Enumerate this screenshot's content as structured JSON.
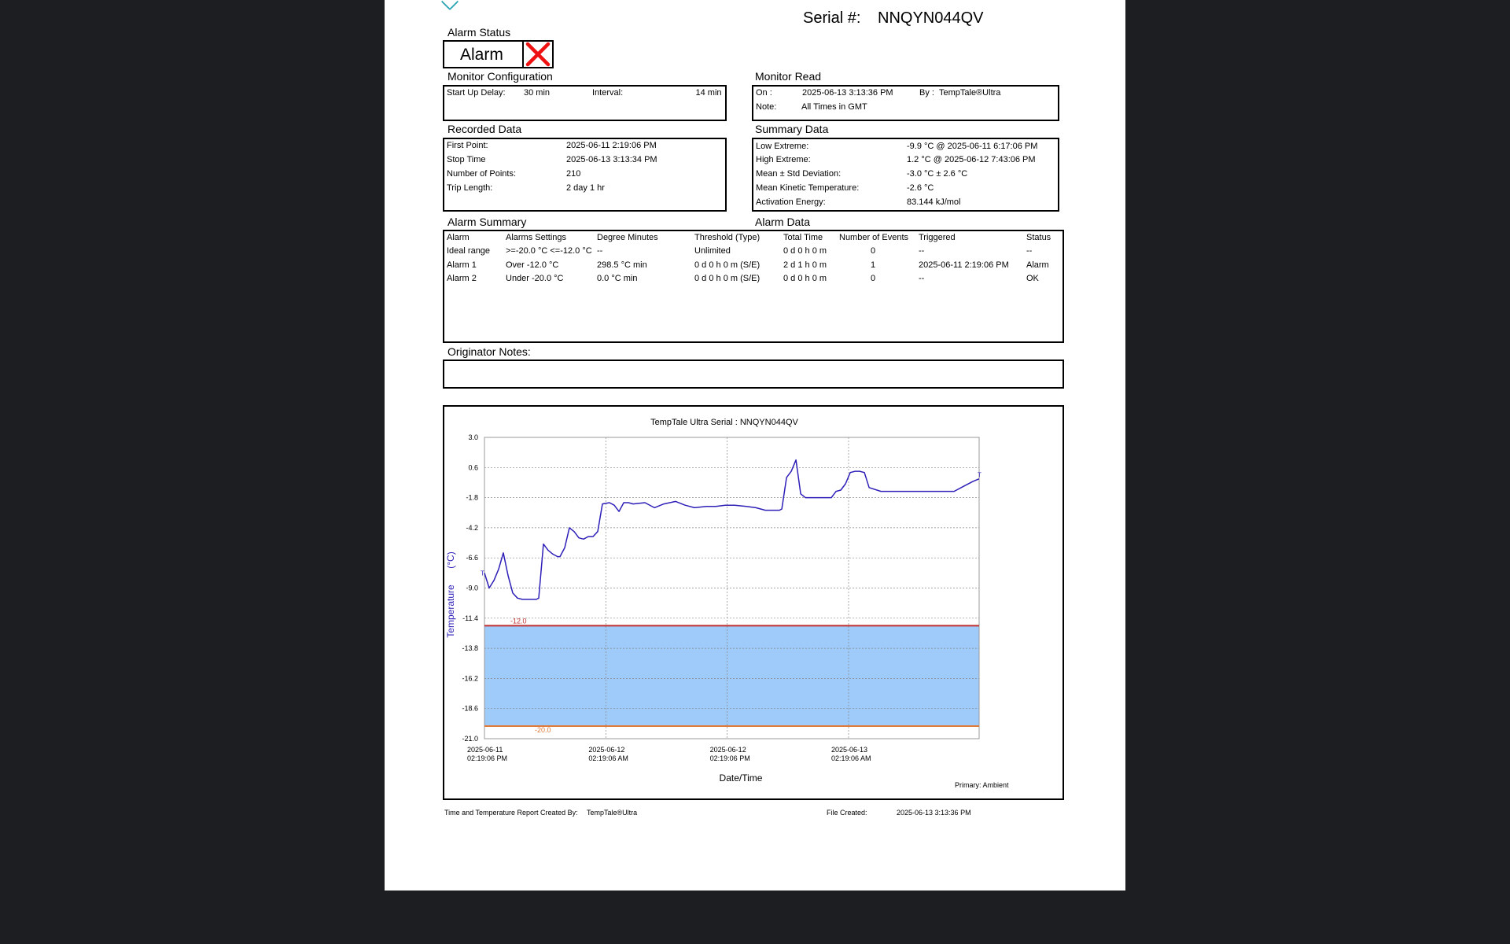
{
  "header": {
    "serial_label": "Serial #:",
    "serial_value": "NNQYN044QV"
  },
  "alarm_status": {
    "title": "Alarm Status",
    "value": "Alarm"
  },
  "monitor_config": {
    "title": "Monitor Configuration",
    "startup_delay_label": "Start Up Delay:",
    "startup_delay_value": "30 min",
    "interval_label": "Interval:",
    "interval_value": "14 min"
  },
  "monitor_read": {
    "title": "Monitor Read",
    "on_label": "On :",
    "on_value": "2025-06-13  3:13:36 PM",
    "by_label": "By :",
    "by_value": "TempTale®Ultra",
    "note_label": "Note:",
    "note_value": "All Times in GMT"
  },
  "recorded_data": {
    "title": "Recorded Data",
    "rows": [
      {
        "label": "First Point:",
        "value": "2025-06-11  2:19:06 PM"
      },
      {
        "label": "Stop Time",
        "value": "2025-06-13  3:13:34 PM"
      },
      {
        "label": "Number of Points:",
        "value": "210"
      },
      {
        "label": "Trip Length:",
        "value": "2 day 1 hr"
      }
    ]
  },
  "summary_data": {
    "title": "Summary Data",
    "rows": [
      {
        "label": "Low Extreme:",
        "value": "-9.9 °C @ 2025-06-11  6:17:06 PM"
      },
      {
        "label": "High Extreme:",
        "value": "1.2 °C @ 2025-06-12  7:43:06 PM"
      },
      {
        "label": "Mean ± Std Deviation:",
        "value": "-3.0 °C ± 2.6 °C"
      },
      {
        "label": "Mean Kinetic Temperature:",
        "value": "-2.6 °C"
      },
      {
        "label": "Activation Energy:",
        "value": "83.144 kJ/mol"
      }
    ]
  },
  "alarm_summary": {
    "title": "Alarm Summary",
    "data_title": "Alarm Data",
    "headers": [
      "Alarm",
      "Alarms Settings",
      "Degree Minutes",
      "Threshold (Type)",
      "Total Time",
      "Number of Events",
      "Triggered",
      "Status"
    ],
    "rows": [
      [
        "Ideal range",
        ">=-20.0 °C <=-12.0 °C",
        "--",
        "Unlimited",
        "0 d 0 h 0 m",
        "0",
        "--",
        "--"
      ],
      [
        "Alarm 1",
        "Over -12.0 °C",
        "298.5 °C min",
        "0 d 0 h 0 m (S/E)",
        "2 d 1 h 0 m",
        "1",
        "2025-06-11  2:19:06 PM",
        "Alarm"
      ],
      [
        "Alarm 2",
        "Under -20.0 °C",
        "0.0 °C min",
        "0 d 0 h 0 m (S/E)",
        "0 d 0 h 0 m",
        "0",
        "--",
        "OK"
      ]
    ]
  },
  "originator_notes": {
    "title": "Originator Notes:"
  },
  "footer": {
    "created_by_label": "Time and Temperature Report Created By:",
    "created_by_value": "TempTale®Ultra",
    "file_created_label": "File Created:",
    "file_created_value": "2025-06-13  3:13:36 PM"
  },
  "chart_data": {
    "type": "line",
    "title": "TempTale Ultra  Serial : NNQYN044QV",
    "xlabel": "Date/Time",
    "ylabel": "Temperature",
    "ylabel_unit": "(°C)",
    "primary_label": "Primary: Ambient",
    "ylim": [
      -21.0,
      3.0
    ],
    "y_ticks": [
      "3.0",
      "0.6",
      "-1.8",
      "-4.2",
      "-6.6",
      "-9.0",
      "-11.4",
      "-13.8",
      "-16.2",
      "-18.6",
      "-21.0"
    ],
    "x_ticks": [
      {
        "date": "2025-06-11",
        "time": "02:19:06 PM"
      },
      {
        "date": "2025-06-12",
        "time": "02:19:06 AM"
      },
      {
        "date": "2025-06-12",
        "time": "02:19:06 PM"
      },
      {
        "date": "2025-06-13",
        "time": "02:19:06 AM"
      }
    ],
    "xlim": [
      "2025-06-11 14:19:06",
      "2025-06-13 15:13:34"
    ],
    "upper_limit": -12.0,
    "lower_limit": -20.0,
    "upper_limit_label": "-12.0",
    "lower_limit_label": "-20.0",
    "trip_markers": [
      "T",
      "T"
    ],
    "band_color": "#9ecbfa",
    "line_color": "#2d1fb8",
    "upper_line_color": "#c03030",
    "lower_line_color": "#e07a3a",
    "series": [
      {
        "x": [
          "2025-06-11 14:19:06",
          "2025-06-11 14:47:06",
          "2025-06-11 15:15:06",
          "2025-06-11 15:43:06",
          "2025-06-11 16:11:06",
          "2025-06-11 16:39:06",
          "2025-06-11 17:07:06",
          "2025-06-11 17:35:06",
          "2025-06-11 18:03:06",
          "2025-06-11 18:31:06",
          "2025-06-11 18:59:06",
          "2025-06-11 19:27:06",
          "2025-06-11 19:41:06",
          "2025-06-11 20:09:06",
          "2025-06-11 20:37:06",
          "2025-06-11 21:05:06",
          "2025-06-11 21:33:06",
          "2025-06-11 21:47:06",
          "2025-06-11 22:15:06",
          "2025-06-11 22:43:06",
          "2025-06-11 23:11:06",
          "2025-06-11 23:39:06",
          "2025-06-12 00:07:06",
          "2025-06-12 00:35:06",
          "2025-06-12 01:03:06",
          "2025-06-12 01:31:06",
          "2025-06-12 01:59:06",
          "2025-06-12 02:41:06",
          "2025-06-12 03:09:06",
          "2025-06-12 03:37:06",
          "2025-06-12 04:05:06",
          "2025-06-12 04:33:06",
          "2025-06-12 05:01:06",
          "2025-06-12 06:11:06",
          "2025-06-12 07:07:06",
          "2025-06-12 08:03:06",
          "2025-06-12 09:13:06",
          "2025-06-12 10:09:06",
          "2025-06-12 11:05:06",
          "2025-06-12 12:15:06",
          "2025-06-12 13:11:06",
          "2025-06-12 14:07:06",
          "2025-06-12 15:03:06",
          "2025-06-12 16:13:06",
          "2025-06-12 17:09:06",
          "2025-06-12 18:05:06",
          "2025-06-12 18:33:06",
          "2025-06-12 19:01:06",
          "2025-06-12 19:29:06",
          "2025-06-12 19:43:06",
          "2025-06-12 20:11:06",
          "2025-06-12 20:39:06",
          "2025-06-12 21:07:06",
          "2025-06-12 21:35:06",
          "2025-06-12 22:03:06",
          "2025-06-12 22:45:06",
          "2025-06-12 23:27:06",
          "2025-06-13 00:09:06",
          "2025-06-13 00:37:06",
          "2025-06-13 01:05:06",
          "2025-06-13 01:33:06",
          "2025-06-13 02:01:06",
          "2025-06-13 02:29:06",
          "2025-06-13 02:57:06",
          "2025-06-13 03:25:06",
          "2025-06-13 03:53:06",
          "2025-06-13 04:21:06",
          "2025-06-13 05:31:06",
          "2025-06-13 07:09:06",
          "2025-06-13 09:01:06",
          "2025-06-13 10:53:06",
          "2025-06-13 12:45:06",
          "2025-06-13 13:41:06",
          "2025-06-13 14:37:06",
          "2025-06-13 15:13:34"
        ],
        "values": [
          -7.8,
          -9.0,
          -8.4,
          -7.5,
          -6.2,
          -8.0,
          -9.4,
          -9.8,
          -9.9,
          -9.9,
          -9.9,
          -9.9,
          -9.8,
          -5.5,
          -6.0,
          -6.3,
          -6.5,
          -6.5,
          -5.8,
          -4.2,
          -4.5,
          -5.0,
          -5.1,
          -4.9,
          -4.9,
          -4.5,
          -2.3,
          -2.2,
          -2.4,
          -2.9,
          -2.2,
          -2.2,
          -2.3,
          -2.2,
          -2.6,
          -2.3,
          -2.1,
          -2.4,
          -2.6,
          -2.5,
          -2.5,
          -2.4,
          -2.4,
          -2.5,
          -2.6,
          -2.8,
          -2.8,
          -2.8,
          -2.8,
          -2.7,
          -0.2,
          0.3,
          1.2,
          -1.5,
          -1.8,
          -1.8,
          -1.8,
          -1.8,
          -1.8,
          -1.3,
          -1.2,
          -0.7,
          0.2,
          0.3,
          0.3,
          0.2,
          -1.0,
          -1.3,
          -1.3,
          -1.3,
          -1.3,
          -1.3,
          -0.9,
          -0.5,
          -0.3
        ]
      }
    ]
  }
}
